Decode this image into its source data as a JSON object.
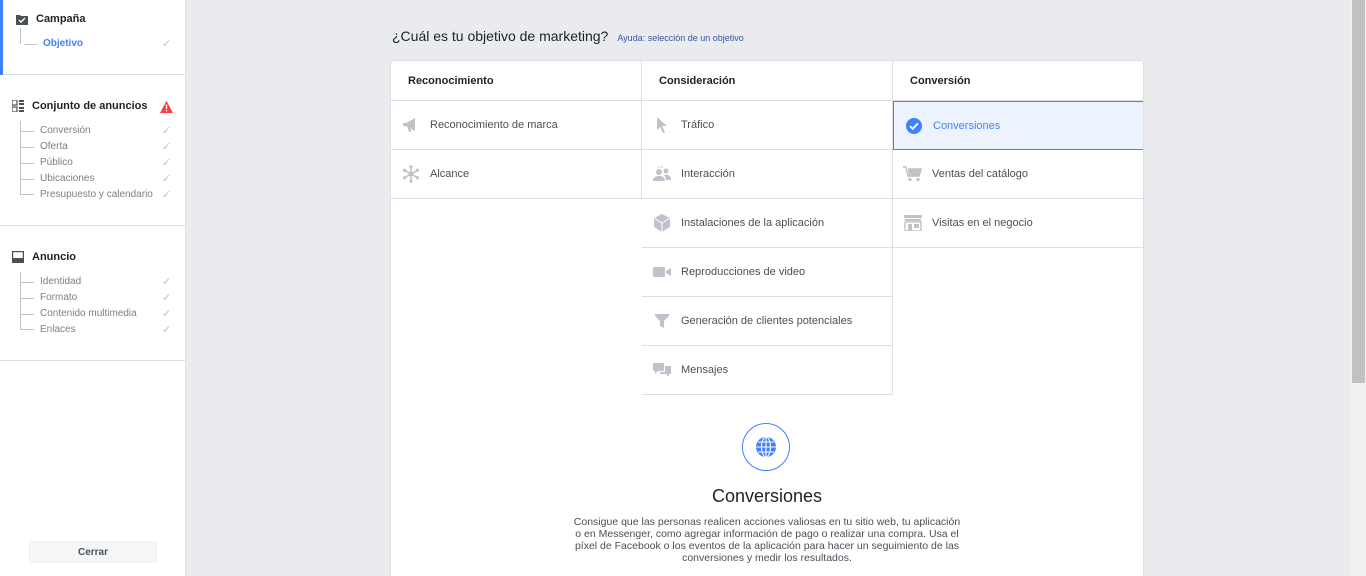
{
  "sidebar": {
    "campaign": {
      "title": "Campaña",
      "items": [
        {
          "label": "Objetivo"
        }
      ]
    },
    "adset": {
      "title": "Conjunto de anuncios",
      "items": [
        {
          "label": "Conversión"
        },
        {
          "label": "Oferta"
        },
        {
          "label": "Público"
        },
        {
          "label": "Ubicaciones"
        },
        {
          "label": "Presupuesto y calendario"
        }
      ]
    },
    "ad": {
      "title": "Anuncio",
      "items": [
        {
          "label": "Identidad"
        },
        {
          "label": "Formato"
        },
        {
          "label": "Contenido multimedia"
        },
        {
          "label": "Enlaces"
        }
      ]
    },
    "check_glyph": "✓",
    "close_label": "Cerrar"
  },
  "main": {
    "question": "¿Cuál es tu objetivo de marketing?",
    "help_link": "Ayuda: selección de un objetivo",
    "columns": [
      {
        "title": "Reconocimiento",
        "items": [
          {
            "label": "Reconocimiento de marca",
            "icon": "megaphone-icon"
          },
          {
            "label": "Alcance",
            "icon": "asterisk-icon"
          }
        ]
      },
      {
        "title": "Consideración",
        "items": [
          {
            "label": "Tráfico",
            "icon": "cursor-icon"
          },
          {
            "label": "Interacción",
            "icon": "people-icon"
          },
          {
            "label": "Instalaciones de la aplicación",
            "icon": "cube-icon"
          },
          {
            "label": "Reproducciones de video",
            "icon": "video-icon"
          },
          {
            "label": "Generación de clientes potenciales",
            "icon": "funnel-icon"
          },
          {
            "label": "Mensajes",
            "icon": "chat-icon"
          }
        ]
      },
      {
        "title": "Conversión",
        "items": [
          {
            "label": "Conversiones",
            "icon": "check-circle-icon",
            "selected": true
          },
          {
            "label": "Ventas del catálogo",
            "icon": "cart-icon"
          },
          {
            "label": "Visitas en el negocio",
            "icon": "store-icon"
          }
        ]
      }
    ],
    "detail": {
      "title": "Conversiones",
      "description": "Consigue que las personas realicen acciones valiosas en tu sitio web, tu aplicación o en Messenger, como agregar información de pago o realizar una compra. Usa el píxel de Facebook o los eventos de la aplicación para hacer un seguimiento de las conversiones y medir los resultados."
    }
  },
  "colors": {
    "accent": "#4080ff",
    "icon_gray": "#bec3c9",
    "warning": "#fa3e3e",
    "link": "#365899"
  }
}
